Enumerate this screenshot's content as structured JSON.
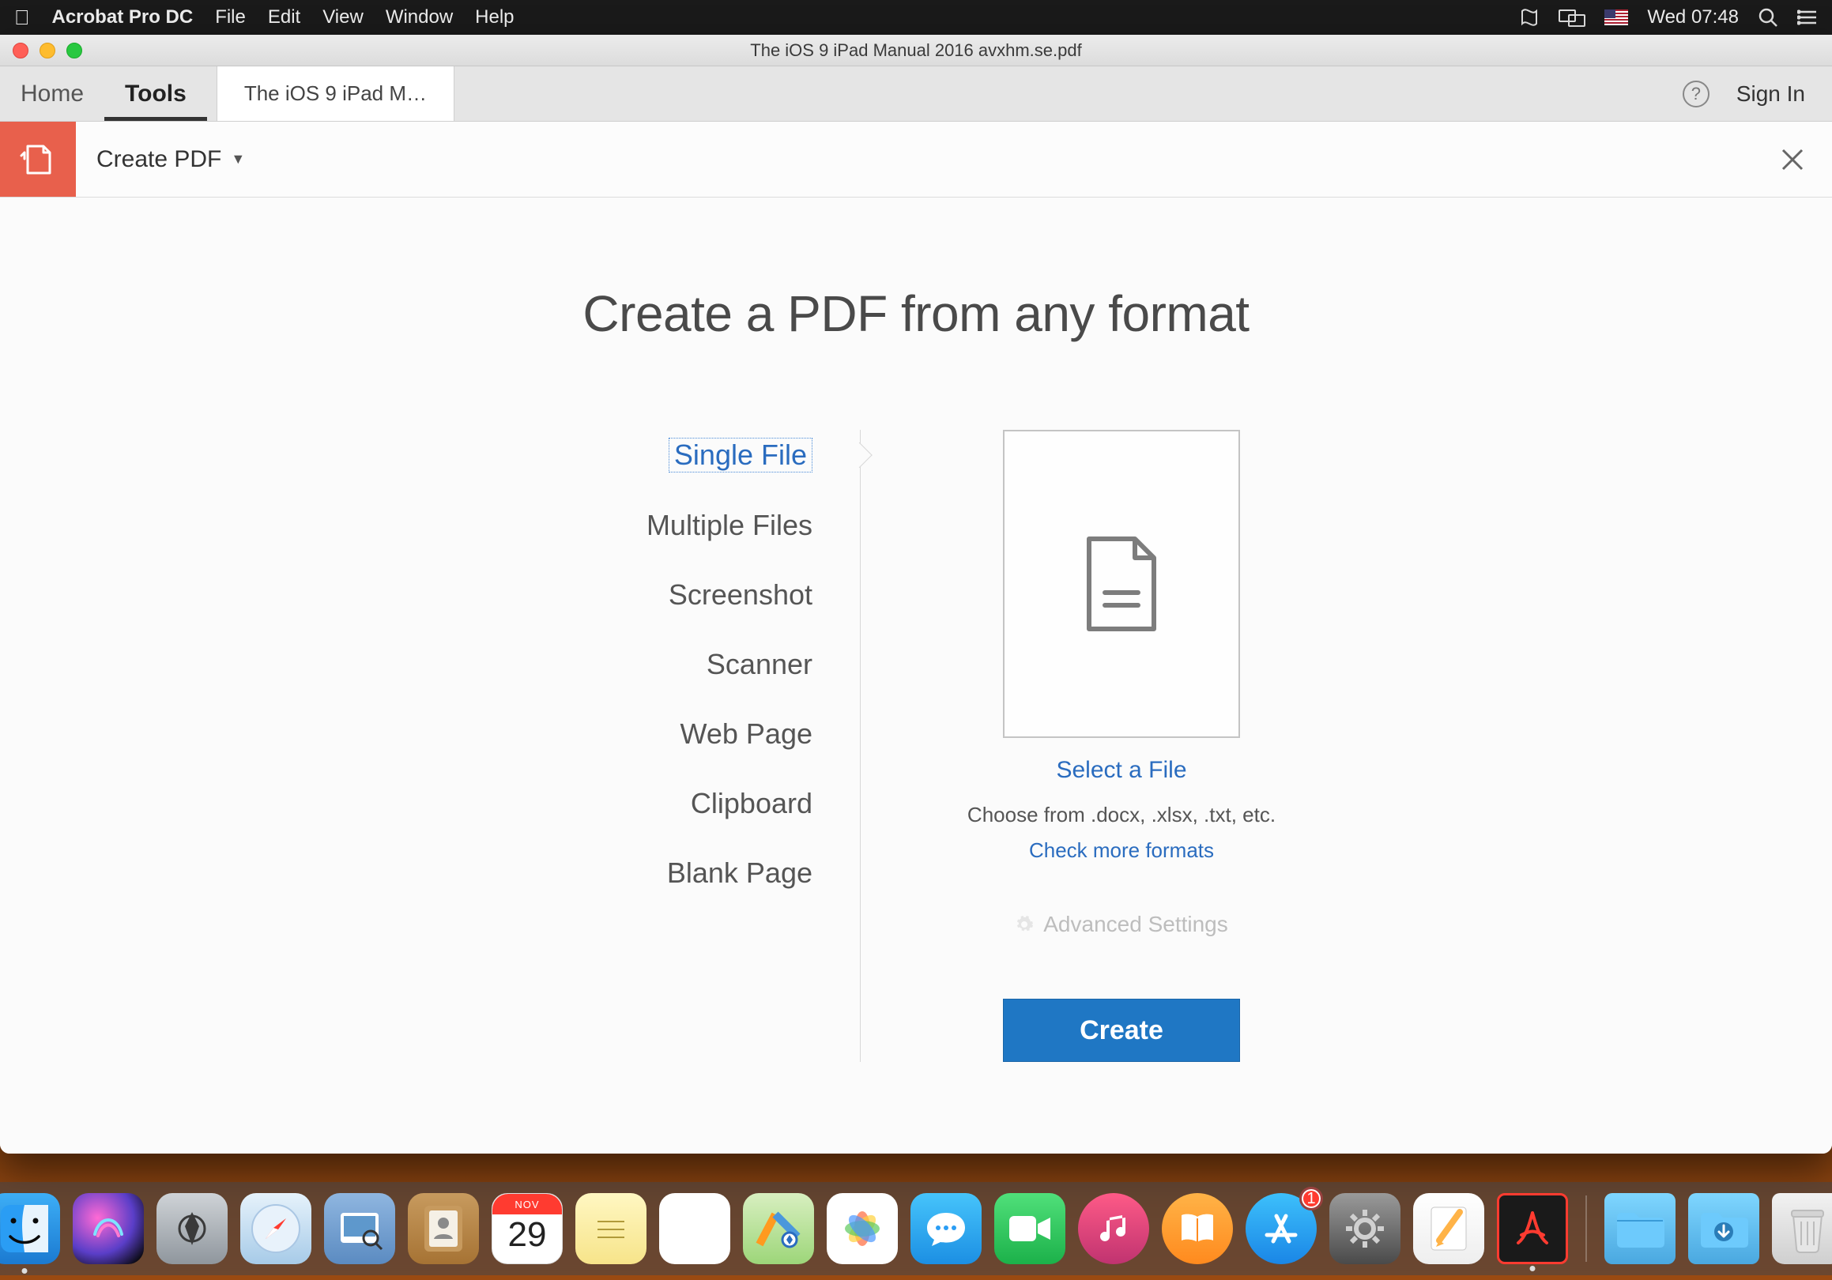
{
  "menubar": {
    "app_name": "Acrobat Pro DC",
    "items": [
      "File",
      "Edit",
      "View",
      "Window",
      "Help"
    ],
    "clock": "Wed 07:48"
  },
  "window": {
    "title": "The iOS 9 iPad Manual 2016 avxhm.se.pdf"
  },
  "tabs": {
    "home": "Home",
    "tools": "Tools",
    "doc": "The iOS 9 iPad M…",
    "sign_in": "Sign In"
  },
  "tool": {
    "label": "Create PDF"
  },
  "main": {
    "heading": "Create a PDF from any format",
    "options": [
      "Single File",
      "Multiple Files",
      "Screenshot",
      "Scanner",
      "Web Page",
      "Clipboard",
      "Blank Page"
    ],
    "select_link": "Select a File",
    "hint": "Choose from .docx, .xlsx, .txt, etc.",
    "more_link": "Check more formats",
    "advanced": "Advanced Settings",
    "create_button": "Create"
  },
  "dock": {
    "calendar_month": "NOV",
    "calendar_day": "29",
    "appstore_badge": "1"
  }
}
